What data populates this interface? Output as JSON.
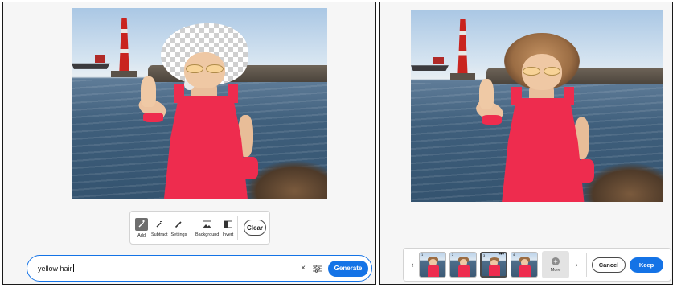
{
  "left_panel": {
    "toolbar": {
      "tools": [
        {
          "label": "Add",
          "icon": "brush-plus-icon",
          "active": true
        },
        {
          "label": "Subtract",
          "icon": "brush-minus-icon",
          "active": false
        },
        {
          "label": "Settings",
          "icon": "brush-settings-icon",
          "active": false
        },
        {
          "label": "Background",
          "icon": "image-icon",
          "active": false
        },
        {
          "label": "Invert",
          "icon": "invert-icon",
          "active": false
        }
      ],
      "clear_label": "Clear"
    },
    "prompt": {
      "value": "yellow hair",
      "clear_icon": "×",
      "generate_label": "Generate"
    }
  },
  "right_panel": {
    "variations": {
      "thumbnails": [
        {
          "number": "1",
          "selected": false,
          "menu": ""
        },
        {
          "number": "2",
          "selected": false,
          "menu": ""
        },
        {
          "number": "3",
          "selected": true,
          "menu": "•••"
        },
        {
          "number": "4",
          "selected": false,
          "menu": ""
        }
      ],
      "prev_icon": "‹",
      "next_icon": "›",
      "more_label": "More",
      "cancel_label": "Cancel",
      "keep_label": "Keep"
    }
  },
  "colors": {
    "accent": "#1473e6",
    "dress": "#ee2c4e"
  }
}
